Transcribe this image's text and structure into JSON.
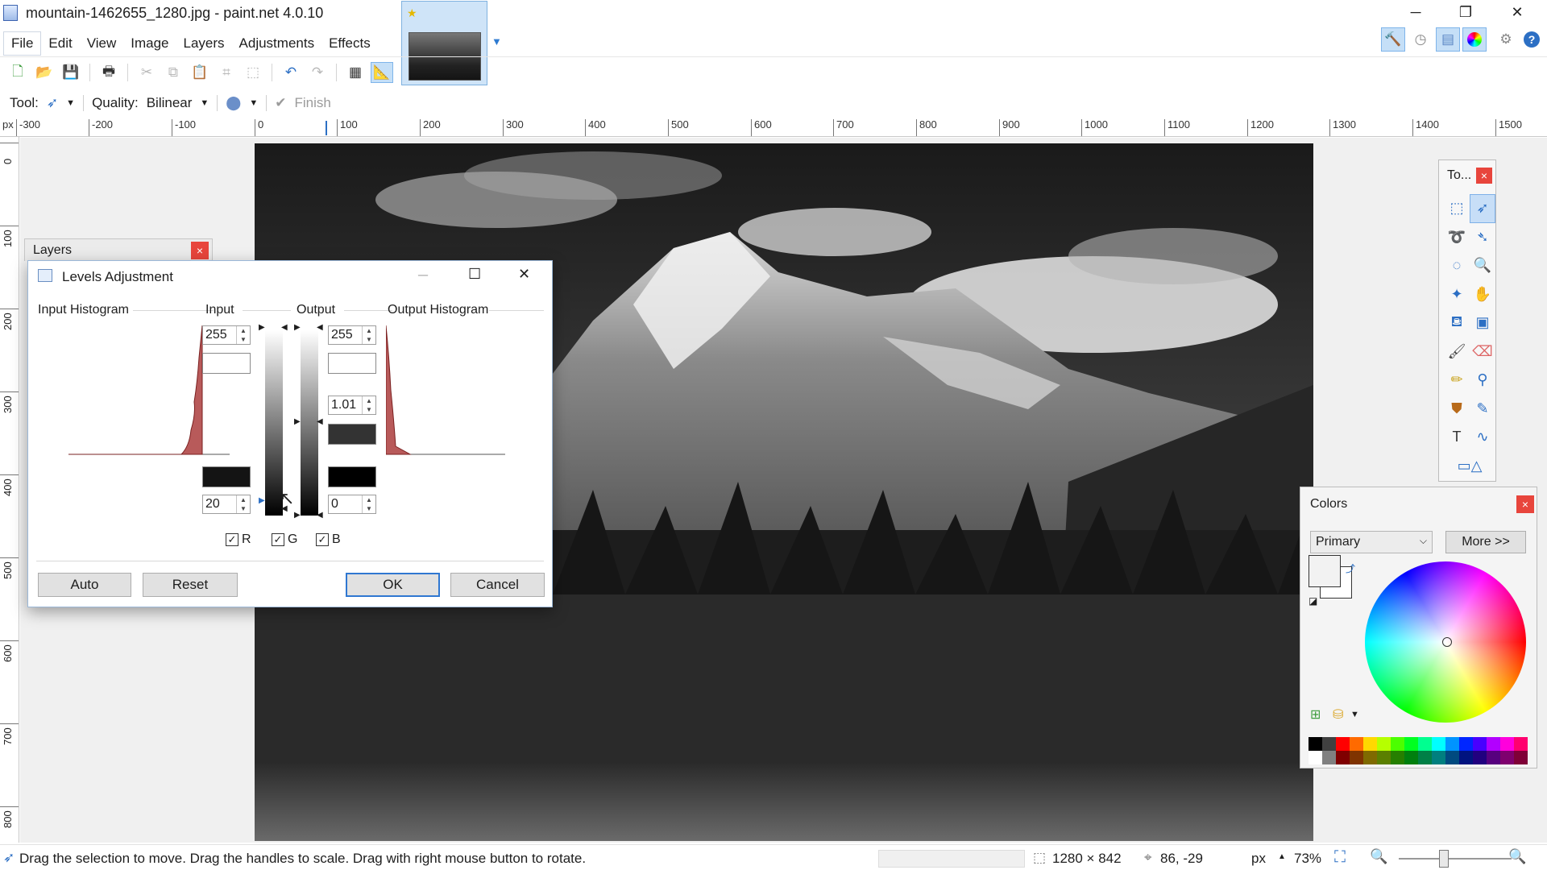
{
  "window": {
    "title": "mountain-1462655_1280.jpg - paint.net 4.0.10",
    "minimize": "─",
    "maximize": "❐",
    "close": "✕"
  },
  "menu": [
    "File",
    "Edit",
    "View",
    "Image",
    "Layers",
    "Adjustments",
    "Effects"
  ],
  "toolbar_icons": [
    "new-icon",
    "open-icon",
    "save-icon",
    "print-icon",
    "cut-icon",
    "copy-icon",
    "paste-icon",
    "crop-icon",
    "deselect-icon",
    "undo-icon",
    "redo-icon",
    "grid-icon",
    "ruler-icon"
  ],
  "tool_options": {
    "tool_label": "Tool:",
    "quality_label": "Quality:",
    "quality_value": "Bilinear",
    "finish_label": "Finish"
  },
  "ruler": {
    "unit": "px",
    "top_labels": [
      "-300",
      "-200",
      "-100",
      "0",
      "100",
      "200",
      "300",
      "400",
      "500",
      "600",
      "700",
      "800",
      "900",
      "1000",
      "1100",
      "1200",
      "1300",
      "1400",
      "1500"
    ],
    "left_labels": [
      "0",
      "100",
      "200",
      "300",
      "400",
      "500",
      "600",
      "700",
      "800"
    ]
  },
  "layers_panel": {
    "title": "Layers",
    "close": "×"
  },
  "levels": {
    "title": "Levels Adjustment",
    "input_histogram": "Input Histogram",
    "input": "Input",
    "output": "Output",
    "output_histogram": "Output Histogram",
    "input_high": "255",
    "input_low": "20",
    "output_high": "255",
    "output_gamma": "1.01",
    "output_low": "0",
    "channels": [
      {
        "label": "R",
        "checked": true
      },
      {
        "label": "G",
        "checked": true
      },
      {
        "label": "B",
        "checked": true
      }
    ],
    "auto": "Auto",
    "reset": "Reset",
    "ok": "OK",
    "cancel": "Cancel"
  },
  "tools_panel": {
    "title": "To...",
    "close": "×",
    "tools": [
      "rectangle-select-icon",
      "move-selection-icon",
      "lasso-select-icon",
      "move-selected-icon",
      "ellipse-select-icon",
      "zoom-icon",
      "magic-wand-icon",
      "pan-icon",
      "paint-bucket-icon",
      "gradient-icon",
      "paintbrush-icon",
      "eraser-icon",
      "pencil-icon",
      "color-picker-icon",
      "clone-stamp-icon",
      "recolor-icon",
      "text-icon",
      "line-curve-icon",
      "shapes-icon"
    ]
  },
  "colors_panel": {
    "title": "Colors",
    "close": "×",
    "primary_select": "Primary",
    "more_button": "More >>",
    "primary_color": "#f2f2f2",
    "secondary_color": "#ffffff"
  },
  "status": {
    "hint": "Drag the selection to move. Drag the handles to scale. Drag with right mouse button to rotate.",
    "image_size": "1280 × 842",
    "cursor_pos": "86, -29",
    "unit": "px",
    "zoom": "73%"
  }
}
